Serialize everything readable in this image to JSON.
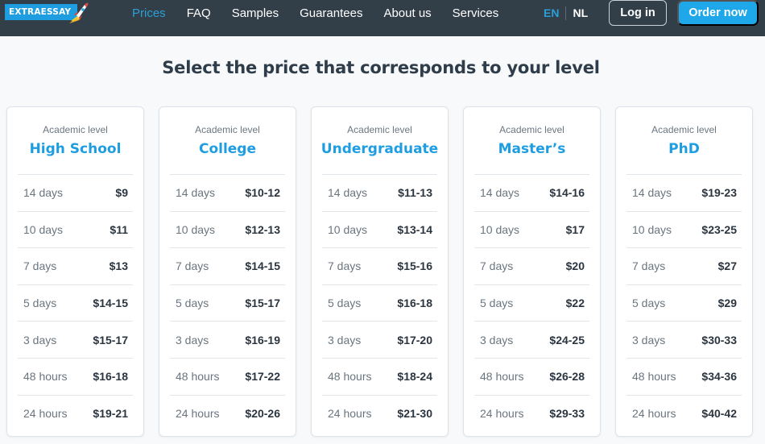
{
  "header": {
    "logo_text": "EXTRAESSAY",
    "nav": [
      {
        "label": "Prices",
        "active": true
      },
      {
        "label": "FAQ",
        "active": false
      },
      {
        "label": "Samples",
        "active": false
      },
      {
        "label": "Guarantees",
        "active": false
      },
      {
        "label": "About us",
        "active": false
      },
      {
        "label": "Services",
        "active": false
      }
    ],
    "languages": {
      "current": "EN",
      "other": "NL"
    },
    "login_label": "Log in",
    "order_label": "Order now"
  },
  "colors": {
    "header_bg": "#323e48",
    "accent": "#1ea8ea",
    "title_text": "#2f3d4a"
  },
  "page_title": "Select the price that corresponds to your level",
  "pricing": {
    "subtitle": "Academic level",
    "levels": [
      {
        "name": "High School",
        "rows": [
          {
            "term": "14 days",
            "price": "$9"
          },
          {
            "term": "10 days",
            "price": "$11"
          },
          {
            "term": "7 days",
            "price": "$13"
          },
          {
            "term": "5 days",
            "price": "$14-15"
          },
          {
            "term": "3 days",
            "price": "$15-17"
          },
          {
            "term": "48 hours",
            "price": "$16-18"
          },
          {
            "term": "24 hours",
            "price": "$19-21"
          }
        ]
      },
      {
        "name": "College",
        "rows": [
          {
            "term": "14 days",
            "price": "$10-12"
          },
          {
            "term": "10 days",
            "price": "$12-13"
          },
          {
            "term": "7 days",
            "price": "$14-15"
          },
          {
            "term": "5 days",
            "price": "$15-17"
          },
          {
            "term": "3 days",
            "price": "$16-19"
          },
          {
            "term": "48 hours",
            "price": "$17-22"
          },
          {
            "term": "24 hours",
            "price": "$20-26"
          }
        ]
      },
      {
        "name": "Undergraduate",
        "rows": [
          {
            "term": "14 days",
            "price": "$11-13"
          },
          {
            "term": "10 days",
            "price": "$13-14"
          },
          {
            "term": "7 days",
            "price": "$15-16"
          },
          {
            "term": "5 days",
            "price": "$16-18"
          },
          {
            "term": "3 days",
            "price": "$17-20"
          },
          {
            "term": "48 hours",
            "price": "$18-24"
          },
          {
            "term": "24 hours",
            "price": "$21-30"
          }
        ]
      },
      {
        "name": "Master’s",
        "rows": [
          {
            "term": "14 days",
            "price": "$14-16"
          },
          {
            "term": "10 days",
            "price": "$17"
          },
          {
            "term": "7 days",
            "price": "$20"
          },
          {
            "term": "5 days",
            "price": "$22"
          },
          {
            "term": "3 days",
            "price": "$24-25"
          },
          {
            "term": "48 hours",
            "price": "$26-28"
          },
          {
            "term": "24 hours",
            "price": "$29-33"
          }
        ]
      },
      {
        "name": "PhD",
        "rows": [
          {
            "term": "14 days",
            "price": "$19-23"
          },
          {
            "term": "10 days",
            "price": "$23-25"
          },
          {
            "term": "7 days",
            "price": "$27"
          },
          {
            "term": "5 days",
            "price": "$29"
          },
          {
            "term": "3 days",
            "price": "$30-33"
          },
          {
            "term": "48 hours",
            "price": "$34-36"
          },
          {
            "term": "24 hours",
            "price": "$40-42"
          }
        ]
      }
    ]
  }
}
